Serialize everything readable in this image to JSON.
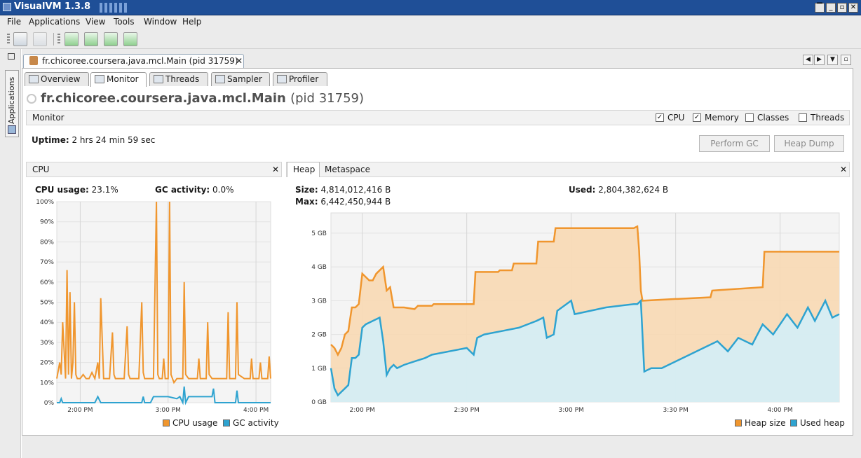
{
  "window": {
    "title": "VisualVM 1.3.8"
  },
  "menu": [
    "File",
    "Applications",
    "View",
    "Tools",
    "Window",
    "Help"
  ],
  "toolbar": {
    "icons": [
      "open-icon",
      "save-icon",
      "add-jmx-icon",
      "heap-dump-icon",
      "thread-dump-icon",
      "snapshot-icon"
    ]
  },
  "sidebar": {
    "label": "Applications"
  },
  "document_tab": {
    "title": "fr.chicoree.coursera.java.mcl.Main (pid 31759)"
  },
  "subtabs": [
    "Overview",
    "Monitor",
    "Threads",
    "Sampler",
    "Profiler"
  ],
  "app": {
    "name": "fr.chicoree.coursera.java.mcl.Main",
    "pid": "(pid 31759)"
  },
  "monitor": {
    "label": "Monitor",
    "checkboxes": [
      {
        "label": "CPU",
        "checked": true
      },
      {
        "label": "Memory",
        "checked": true
      },
      {
        "label": "Classes",
        "checked": false
      },
      {
        "label": "Threads",
        "checked": false
      }
    ],
    "uptime_label": "Uptime:",
    "uptime_value": "2 hrs 24 min 59 sec",
    "perform_gc": "Perform GC",
    "heap_dump": "Heap Dump"
  },
  "cpu_panel": {
    "tab": "CPU",
    "cpu_usage_label": "CPU usage:",
    "cpu_usage_value": "23.1%",
    "gc_activity_label": "GC activity:",
    "gc_activity_value": "0.0%",
    "legend": [
      "CPU usage",
      "GC activity"
    ]
  },
  "heap_panel": {
    "tabs": [
      "Heap",
      "Metaspace"
    ],
    "size_label": "Size:",
    "size_value": "4,814,012,416 B",
    "max_label": "Max:",
    "max_value": "6,442,450,944 B",
    "used_label": "Used:",
    "used_value": "2,804,382,624 B",
    "legend": [
      "Heap size",
      "Used heap"
    ]
  },
  "colors": {
    "cpu": "#f0962e",
    "gc": "#2ea3d0",
    "heap_fill": "#f8d9b4",
    "used_fill": "#d3eef8",
    "titlebar": "#1f4f97"
  },
  "chart_data": [
    {
      "type": "line",
      "name": "CPU",
      "x_ticks": [
        "2:00 PM",
        "3:00 PM",
        "4:00 PM"
      ],
      "x_tick_minutes": [
        120,
        180,
        240
      ],
      "xlim_minutes": [
        104,
        250
      ],
      "y_ticks": [
        "0%",
        "10%",
        "20%",
        "30%",
        "40%",
        "50%",
        "60%",
        "70%",
        "80%",
        "90%",
        "100%"
      ],
      "ylim": [
        0,
        100
      ],
      "series": [
        {
          "name": "CPU usage",
          "color": "#f0962e",
          "x": [
            104,
            106,
            107,
            108,
            110,
            111,
            112,
            113,
            114,
            115,
            116,
            117,
            118,
            120,
            122,
            124,
            126,
            128,
            130,
            132,
            133,
            134,
            136,
            140,
            142,
            143,
            144,
            146,
            150,
            152,
            153,
            154,
            160,
            162,
            163,
            164,
            170,
            172,
            173,
            174,
            176,
            177,
            178,
            180,
            181,
            182,
            184,
            186,
            188,
            190,
            191,
            192,
            194,
            196,
            198,
            200,
            201,
            202,
            206,
            207,
            208,
            210,
            212,
            220,
            221,
            222,
            226,
            227,
            228,
            232,
            236,
            237,
            238,
            242,
            243,
            244,
            246,
            248,
            249,
            250
          ],
          "values": [
            12,
            20,
            14,
            40,
            12,
            66,
            14,
            55,
            12,
            20,
            50,
            14,
            12,
            12,
            14,
            12,
            12,
            15,
            12,
            20,
            12,
            52,
            12,
            12,
            35,
            14,
            12,
            12,
            12,
            38,
            14,
            12,
            12,
            50,
            15,
            12,
            12,
            100,
            14,
            12,
            12,
            22,
            12,
            12,
            100,
            14,
            10,
            12,
            12,
            12,
            60,
            14,
            12,
            12,
            12,
            12,
            22,
            12,
            12,
            40,
            14,
            12,
            12,
            12,
            45,
            12,
            12,
            50,
            14,
            12,
            12,
            22,
            12,
            12,
            20,
            12,
            12,
            12,
            23,
            12
          ]
        },
        {
          "name": "GC activity",
          "color": "#2ea3d0",
          "x": [
            104,
            106,
            107,
            108,
            130,
            132,
            134,
            160,
            162,
            163,
            164,
            168,
            170,
            175,
            180,
            186,
            188,
            190,
            191,
            192,
            194,
            200,
            210,
            211,
            212,
            226,
            227,
            228,
            240,
            250
          ],
          "values": [
            0,
            0,
            2,
            0,
            0,
            3,
            0,
            0,
            0,
            3,
            0,
            0,
            3,
            3,
            3,
            2,
            3,
            0,
            8,
            0,
            3,
            3,
            3,
            7,
            0,
            0,
            6,
            0,
            0,
            0
          ]
        }
      ],
      "legend": [
        "CPU usage",
        "GC activity"
      ]
    },
    {
      "type": "area",
      "name": "Heap",
      "x_ticks": [
        "2:00 PM",
        "2:30 PM",
        "3:00 PM",
        "3:30 PM",
        "4:00 PM"
      ],
      "x_tick_minutes": [
        120,
        150,
        180,
        210,
        240
      ],
      "xlim_minutes": [
        111,
        257
      ],
      "y_ticks": [
        "0 GB",
        "1 GB",
        "2 GB",
        "3 GB",
        "4 GB",
        "5 GB"
      ],
      "ylim_gb": [
        0,
        5.6
      ],
      "series": [
        {
          "name": "Heap size",
          "color": "#f0962e",
          "x": [
            111,
            112,
            113,
            114,
            115,
            116,
            117,
            118,
            119,
            120,
            121,
            122,
            123,
            124,
            126,
            127,
            128,
            129,
            130,
            132,
            135,
            136,
            140,
            140.5,
            152,
            152.5,
            159,
            159.5,
            163,
            163.5,
            170,
            170.5,
            175,
            175.5,
            180,
            180.5,
            198,
            199,
            199.5,
            200,
            200.5,
            210,
            210.5,
            220,
            220.5,
            235,
            235.5,
            257
          ],
          "values": [
            1.7,
            1.6,
            1.4,
            1.6,
            2.0,
            2.1,
            2.8,
            2.8,
            2.9,
            3.8,
            3.7,
            3.6,
            3.6,
            3.8,
            4.0,
            3.3,
            3.4,
            2.8,
            2.8,
            2.8,
            2.75,
            2.85,
            2.85,
            2.9,
            2.9,
            3.85,
            3.85,
            3.9,
            3.9,
            4.1,
            4.1,
            4.75,
            4.75,
            5.15,
            5.15,
            5.15,
            5.15,
            5.2,
            4.5,
            3.3,
            3.0,
            3.05,
            3.05,
            3.1,
            3.3,
            3.4,
            4.45,
            4.45
          ]
        },
        {
          "name": "Used heap",
          "color": "#2ea3d0",
          "x": [
            111,
            112,
            113,
            114,
            115,
            116,
            117,
            118,
            119,
            120,
            121,
            123,
            125,
            126,
            127,
            128,
            129,
            130,
            132,
            135,
            138,
            140,
            145,
            150,
            152,
            153,
            155,
            160,
            165,
            170,
            172,
            173,
            175,
            176,
            180,
            181,
            190,
            198,
            199,
            200,
            201,
            203,
            206,
            210,
            214,
            218,
            222,
            225,
            228,
            232,
            235,
            238,
            242,
            245,
            248,
            250,
            253,
            255,
            257
          ],
          "values": [
            1.0,
            0.4,
            0.2,
            0.3,
            0.4,
            0.5,
            1.3,
            1.3,
            1.4,
            2.2,
            2.3,
            2.4,
            2.5,
            1.8,
            0.8,
            1.0,
            1.1,
            1.0,
            1.1,
            1.2,
            1.3,
            1.4,
            1.5,
            1.6,
            1.4,
            1.9,
            2.0,
            2.1,
            2.2,
            2.4,
            2.5,
            1.9,
            2.0,
            2.7,
            3.0,
            2.6,
            2.8,
            2.9,
            2.9,
            3.0,
            0.9,
            1.0,
            1.0,
            1.2,
            1.4,
            1.6,
            1.8,
            1.5,
            1.9,
            1.7,
            2.3,
            2.0,
            2.6,
            2.2,
            2.8,
            2.4,
            3.0,
            2.5,
            2.6
          ]
        }
      ],
      "legend": [
        "Heap size",
        "Used heap"
      ]
    }
  ]
}
